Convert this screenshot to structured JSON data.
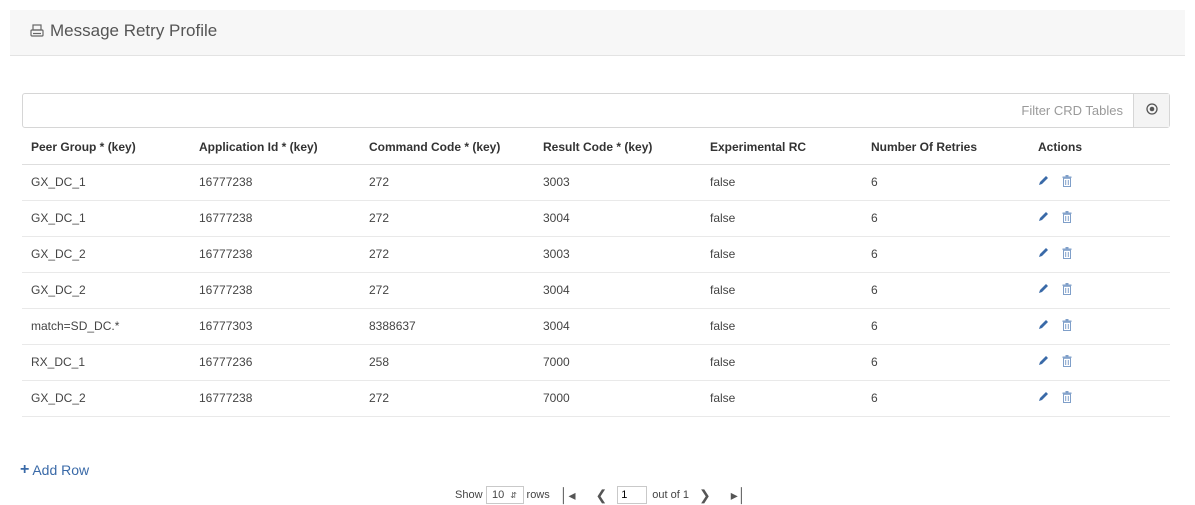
{
  "header": {
    "title": "Message Retry Profile",
    "icon": "printer-icon"
  },
  "filter": {
    "placeholder": "Filter CRD Tables",
    "value": ""
  },
  "table": {
    "columns": [
      "Peer Group * (key)",
      "Application Id * (key)",
      "Command Code * (key)",
      "Result Code * (key)",
      "Experimental RC",
      "Number Of Retries",
      "Actions"
    ],
    "rows": [
      [
        "GX_DC_1",
        "16777238",
        "272",
        "3003",
        "false",
        "6"
      ],
      [
        "GX_DC_1",
        "16777238",
        "272",
        "3004",
        "false",
        "6"
      ],
      [
        "GX_DC_2",
        "16777238",
        "272",
        "3003",
        "false",
        "6"
      ],
      [
        "GX_DC_2",
        "16777238",
        "272",
        "3004",
        "false",
        "6"
      ],
      [
        "match=SD_DC.*",
        "16777303",
        "8388637",
        "3004",
        "false",
        "6"
      ],
      [
        "RX_DC_1",
        "16777236",
        "258",
        "7000",
        "false",
        "6"
      ],
      [
        "GX_DC_2",
        "16777238",
        "272",
        "7000",
        "false",
        "6"
      ]
    ],
    "action_icons": [
      "pencil-icon",
      "trash-icon"
    ]
  },
  "add_row": {
    "label": "Add Row"
  },
  "pagination": {
    "show_label": "Show",
    "rows_per_page": "10",
    "rows_label": "rows",
    "current_page": "1",
    "out_of_label": "out of 1"
  },
  "colors": {
    "link": "#3a6aa8",
    "action_icon": "#3a6aa8",
    "header_bg": "#f7f7f7"
  }
}
